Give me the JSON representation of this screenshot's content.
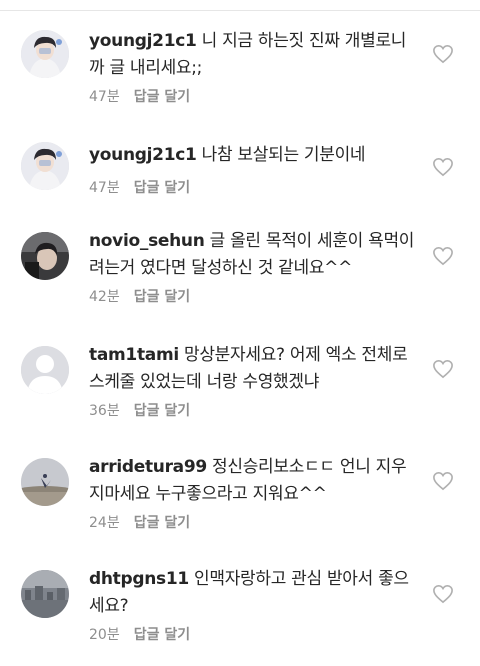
{
  "comments": [
    {
      "username": "youngj21c1",
      "text": "니 지금 하는짓 진짜 개별로니까 글 내리세요;;",
      "time": "47분",
      "reply_label": "답글 달기",
      "avatar_icon": "profile-photo-icon"
    },
    {
      "username": "youngj21c1",
      "text": "나참 보살되는 기분이네",
      "time": "47분",
      "reply_label": "답글 달기",
      "avatar_icon": "profile-photo-icon"
    },
    {
      "username": "novio_sehun",
      "text": "글 올린 목적이 세훈이 욕먹이려는거 였다면 달성하신 것 같네요^^",
      "time": "42분",
      "reply_label": "답글 달기",
      "avatar_icon": "profile-photo-icon"
    },
    {
      "username": "tam1tami",
      "text": "망상분자세요? 어제 엑소 전체로 스케줄 있었는데 너랑 수영했겠냐",
      "time": "36분",
      "reply_label": "답글 달기",
      "avatar_icon": "default-avatar-icon"
    },
    {
      "username": "arridetura99",
      "text": "정신승리보소ㄷㄷ 언니 지우지마세요 누구좋으라고 지워요^^",
      "time": "24분",
      "reply_label": "답글 달기",
      "avatar_icon": "profile-photo-icon"
    },
    {
      "username": "dhtpgns11",
      "text": "인맥자랑하고 관심 받아서 좋으세요?",
      "time": "20분",
      "reply_label": "답글 달기",
      "avatar_icon": "profile-photo-icon"
    }
  ],
  "icons": {
    "like": "heart-outline-icon"
  },
  "colors": {
    "username": "#262626",
    "text": "#262626",
    "meta": "#8e8e8e",
    "divider": "#e6e6e6",
    "icon": "#b0b0b0"
  }
}
